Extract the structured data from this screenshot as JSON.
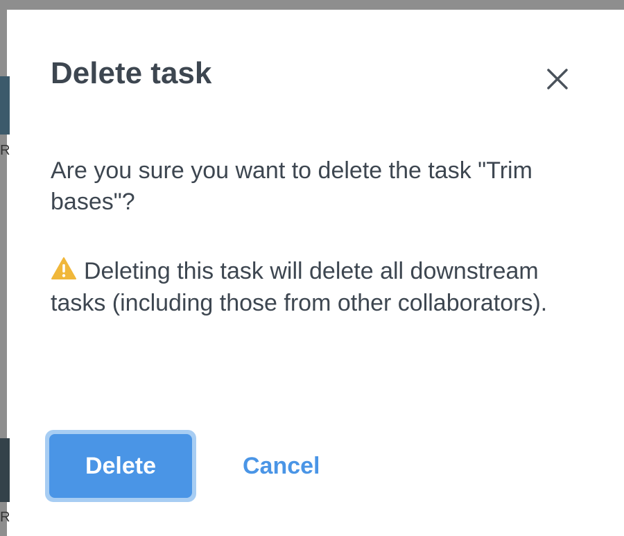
{
  "dialog": {
    "title": "Delete task",
    "message": "Are you sure you want to delete the task \"Trim bases\"?",
    "warning": "Deleting this task will delete all downstream tasks (including those from other collaborators).",
    "buttons": {
      "delete_label": "Delete",
      "cancel_label": "Cancel"
    },
    "icons": {
      "close": "close-icon",
      "warning": "warning-icon"
    }
  },
  "background": {
    "edge_letters": [
      "R",
      "R"
    ]
  },
  "colors": {
    "primary": "#4a95e6",
    "focus_ring": "#a7cdf3",
    "text": "#3d4650",
    "warning": "#f0b73a"
  }
}
